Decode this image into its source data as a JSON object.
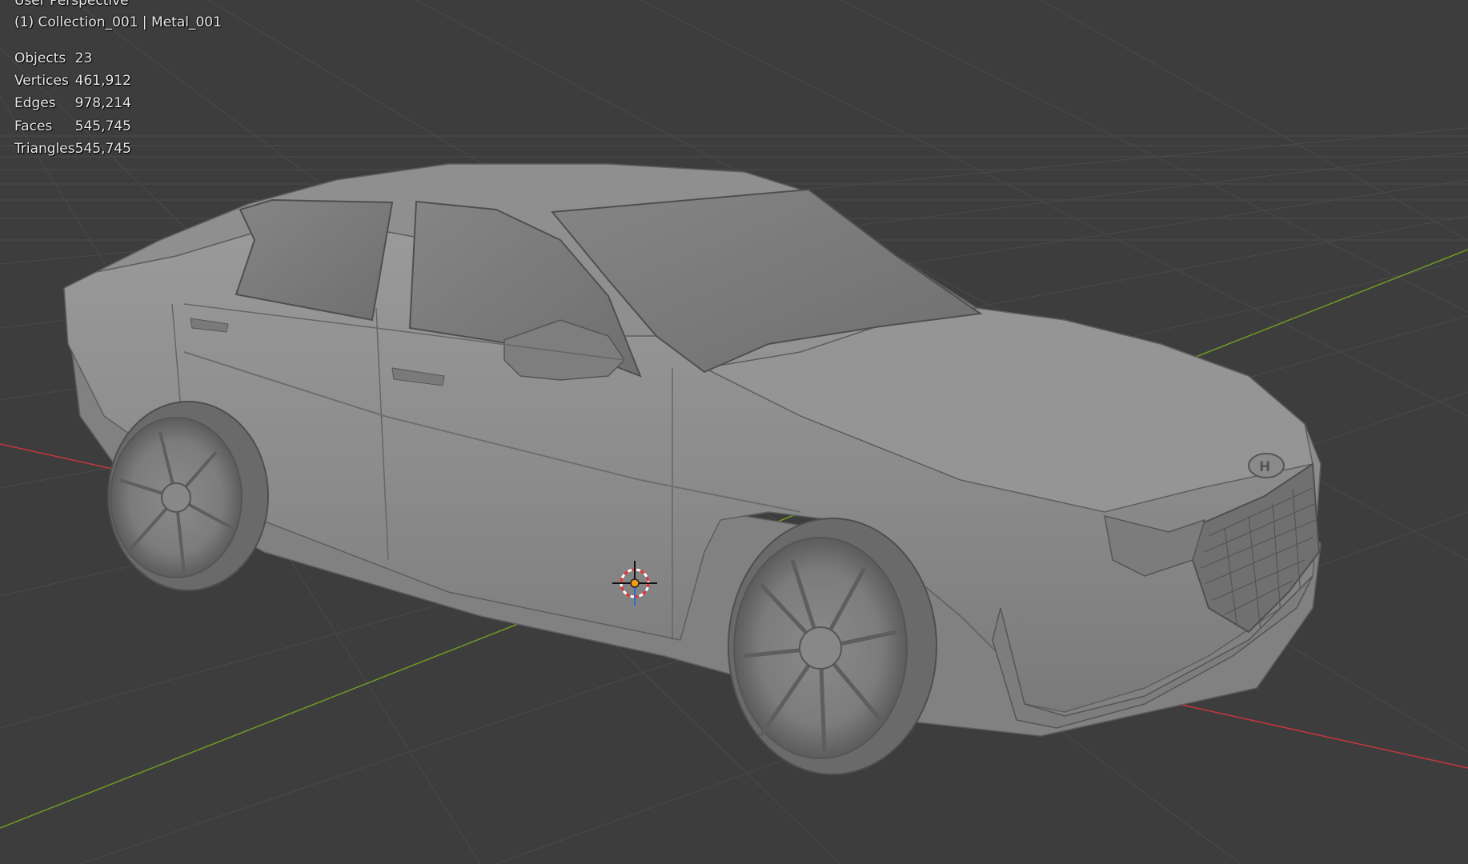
{
  "viewport": {
    "view_name": "User Perspective",
    "context": "(1) Collection_001 | Metal_001",
    "stats": [
      {
        "label": "Objects",
        "value": "23"
      },
      {
        "label": "Vertices",
        "value": "461,912"
      },
      {
        "label": "Edges",
        "value": "978,214"
      },
      {
        "label": "Faces",
        "value": "545,745"
      },
      {
        "label": "Triangles",
        "value": "545,745"
      }
    ]
  },
  "colors": {
    "background": "#3d3d3d",
    "grid": "#4a4a4a",
    "x_axis": "#c7363f",
    "y_axis": "#6f9a25",
    "model": "#8a8a8a"
  },
  "icons": {
    "cursor": "3d-cursor-icon",
    "model": "car-model"
  }
}
